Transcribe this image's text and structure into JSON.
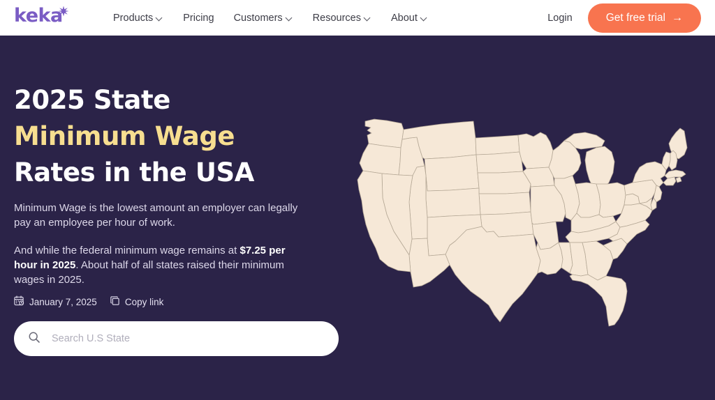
{
  "brand": {
    "logo_text": "keka",
    "logo_color": "#7a5cc4",
    "accent_orange": "#f8744f",
    "accent_yellow": "#f7de90",
    "background": "#2b2348",
    "map_fill": "#f6e8d7"
  },
  "nav": {
    "items": [
      {
        "label": "Products",
        "has_dropdown": true
      },
      {
        "label": "Pricing",
        "has_dropdown": false
      },
      {
        "label": "Customers",
        "has_dropdown": true
      },
      {
        "label": "Resources",
        "has_dropdown": true
      },
      {
        "label": "About",
        "has_dropdown": true
      }
    ],
    "login_label": "Login",
    "cta_label": "Get free trial",
    "cta_arrow": "→"
  },
  "hero": {
    "heading_line1": "2025 State",
    "heading_line2": "Minimum Wage",
    "heading_line3": "Rates in the USA",
    "paragraph1": "Minimum Wage is the lowest amount an employer can legally pay an employee per hour of work.",
    "paragraph2_before": "And while the federal minimum wage remains at ",
    "paragraph2_bold": "$7.25 per hour in 2025",
    "paragraph2_after": ". About half of all states raised their minimum wages in 2025."
  },
  "meta": {
    "date": "January 7, 2025",
    "copy_link_label": "Copy link"
  },
  "search": {
    "placeholder": "Search U.S State",
    "value": ""
  },
  "map": {
    "region": "Contiguous United States"
  }
}
